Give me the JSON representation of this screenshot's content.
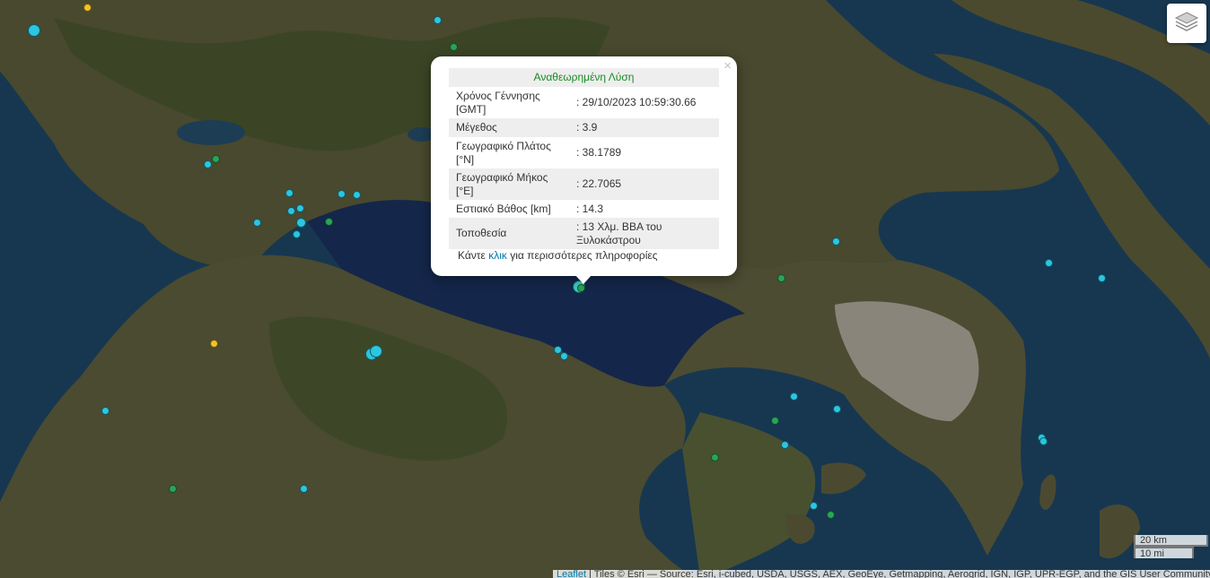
{
  "map": {
    "colors": {
      "sea": "#173750",
      "land": "#4a4b30",
      "mountain": "#3c4626",
      "urban": "#8a857a"
    }
  },
  "layers_control": {
    "icon": "layers-icon"
  },
  "popup": {
    "heading": "Αναθεωρημένη Λύση",
    "close_symbol": "×",
    "rows": [
      {
        "label": "Χρόνος Γέννησης [GMT]",
        "value": ": 29/10/2023 10:59:30.66"
      },
      {
        "label": "Μέγεθος",
        "value": ": 3.9"
      },
      {
        "label": "Γεωγραφικό Πλάτος [°N]",
        "value": ": 38.1789"
      },
      {
        "label": "Γεωγραφικό Μήκος [°E]",
        "value": ": 22.7065"
      },
      {
        "label": "Εστιακό Βάθος [km]",
        "value": ": 14.3"
      },
      {
        "label": "Τοποθεσία",
        "value": ": 13 Χλμ. ΒΒΑ του Ξυλοκάστρου"
      }
    ],
    "more_prefix": "Κάντε ",
    "more_link": "κλικ",
    "more_suffix": " για περισσότερες πληροφορίες"
  },
  "scale": {
    "km": "20 km",
    "mi": "10 mi"
  },
  "attribution": {
    "leaflet": "Leaflet",
    "text": " | Tiles © Esri — Source: Esri, i-cubed, USDA, USGS, AEX, GeoEye, Getmapping, Aerogrid, IGN, IGP, UPR-EGP, and the GIS User Community"
  }
}
